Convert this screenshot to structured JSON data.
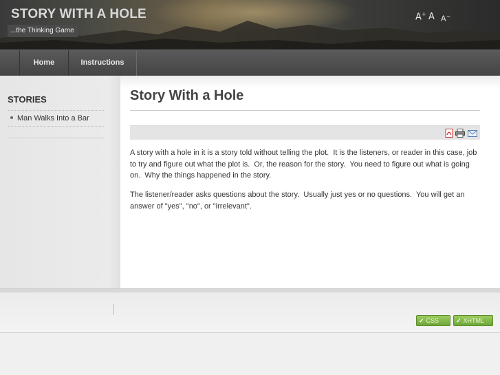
{
  "header": {
    "site_title": "STORY WITH A HOLE",
    "slogan": "...the Thinking Game",
    "font_size_controls": {
      "increase": "A",
      "increase_sup": "+",
      "reset": "A",
      "decrease": "A",
      "decrease_sup": "−"
    }
  },
  "nav": {
    "items": [
      {
        "label": "Home"
      },
      {
        "label": "Instructions"
      }
    ]
  },
  "sidebar": {
    "title": "STORIES",
    "links": [
      {
        "label": "Man Walks Into a Bar"
      }
    ]
  },
  "article": {
    "title": "Story With a Hole",
    "toolbar_icons": [
      "pdf-icon",
      "print-icon",
      "email-icon"
    ],
    "paragraphs": [
      "A story with a hole in it is a story told without telling the plot.  It is the listeners, or reader in this case, job to try and figure out what the plot is.  Or, the reason for the story.  You need to figure out what is going on.  Why the things happened in the story.",
      "The listener/reader asks questions about the story.  Usually just yes or no questions.  You will get an answer of \"yes\", \"no\", or \"irrelevant\"."
    ]
  },
  "footer": {
    "badges": [
      {
        "label": "CSS"
      },
      {
        "label": "XHTML"
      }
    ]
  },
  "colors": {
    "nav_bg": "#4c4c4c",
    "badge_green": "#7fb446",
    "title_text": "#444444"
  }
}
